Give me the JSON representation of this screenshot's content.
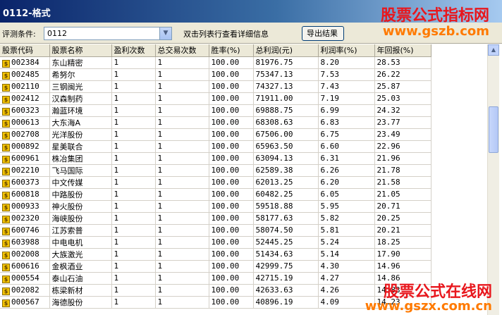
{
  "window": {
    "title": "0112-格式"
  },
  "toolbar": {
    "condition_label": "评测条件:",
    "condition_value": "0112",
    "hint": "双击列表行查看详细信息",
    "export_label": "导出结果"
  },
  "table": {
    "columns": [
      "股票代码",
      "股票名称",
      "盈利次数",
      "总交易次数",
      "胜率(%)",
      "总利润(元)",
      "利润率(%)",
      "年回报(%)"
    ],
    "rows": [
      [
        "002384",
        "东山精密",
        "1",
        "1",
        "100.00",
        "81976.75",
        "8.20",
        "28.53"
      ],
      [
        "002485",
        "希努尔",
        "1",
        "1",
        "100.00",
        "75347.13",
        "7.53",
        "26.22"
      ],
      [
        "002110",
        "三钢闽光",
        "1",
        "1",
        "100.00",
        "74327.13",
        "7.43",
        "25.87"
      ],
      [
        "002412",
        "汉森制药",
        "1",
        "1",
        "100.00",
        "71911.00",
        "7.19",
        "25.03"
      ],
      [
        "600323",
        "瀚蓝环境",
        "1",
        "1",
        "100.00",
        "69888.75",
        "6.99",
        "24.32"
      ],
      [
        "000613",
        "大东海A",
        "1",
        "1",
        "100.00",
        "68308.63",
        "6.83",
        "23.77"
      ],
      [
        "002708",
        "光洋股份",
        "1",
        "1",
        "100.00",
        "67506.00",
        "6.75",
        "23.49"
      ],
      [
        "000892",
        "星美联合",
        "1",
        "1",
        "100.00",
        "65963.50",
        "6.60",
        "22.96"
      ],
      [
        "600961",
        "株冶集团",
        "1",
        "1",
        "100.00",
        "63094.13",
        "6.31",
        "21.96"
      ],
      [
        "002210",
        "飞马国际",
        "1",
        "1",
        "100.00",
        "62589.38",
        "6.26",
        "21.78"
      ],
      [
        "600373",
        "中文传媒",
        "1",
        "1",
        "100.00",
        "62013.25",
        "6.20",
        "21.58"
      ],
      [
        "600818",
        "中路股份",
        "1",
        "1",
        "100.00",
        "60482.25",
        "6.05",
        "21.05"
      ],
      [
        "000933",
        "神火股份",
        "1",
        "1",
        "100.00",
        "59518.88",
        "5.95",
        "20.71"
      ],
      [
        "002320",
        "海峡股份",
        "1",
        "1",
        "100.00",
        "58177.63",
        "5.82",
        "20.25"
      ],
      [
        "600746",
        "江苏索普",
        "1",
        "1",
        "100.00",
        "58074.50",
        "5.81",
        "20.21"
      ],
      [
        "603988",
        "中电电机",
        "1",
        "1",
        "100.00",
        "52445.25",
        "5.24",
        "18.25"
      ],
      [
        "002008",
        "大族激光",
        "1",
        "1",
        "100.00",
        "51434.63",
        "5.14",
        "17.90"
      ],
      [
        "600616",
        "金枫酒业",
        "1",
        "1",
        "100.00",
        "42999.75",
        "4.30",
        "14.96"
      ],
      [
        "000554",
        "泰山石油",
        "1",
        "1",
        "100.00",
        "42715.19",
        "4.27",
        "14.86"
      ],
      [
        "002082",
        "栋梁新材",
        "1",
        "1",
        "100.00",
        "42633.63",
        "4.26",
        "14.83"
      ],
      [
        "000567",
        "海德股份",
        "1",
        "1",
        "100.00",
        "40896.19",
        "4.09",
        "14.23"
      ]
    ]
  },
  "watermarks": {
    "top_title": "股票公式指标网",
    "top_url": "www.gszb.com",
    "bottom_title": "股票公式在线网",
    "bottom_url": "www.gszx.com.cn"
  },
  "colors": {
    "watermark_red": "#e8171d",
    "watermark_orange": "#ff7a00",
    "titlebar": "#0a246a"
  },
  "icons": {
    "row_icon": "dollar-icon",
    "dropdown": "chevron-down-icon",
    "scroll_up": "arrow-up-icon"
  }
}
